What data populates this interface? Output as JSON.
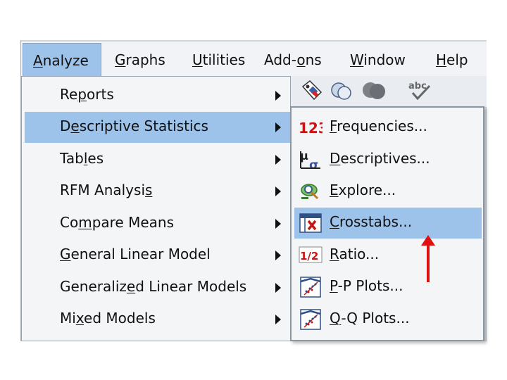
{
  "menubar": {
    "items": [
      {
        "label": "Analyze",
        "u": 0,
        "active": true
      },
      {
        "label": "Graphs",
        "u": 0
      },
      {
        "label": "Utilities",
        "u": 0
      },
      {
        "label": "Add-ons",
        "u": 4
      },
      {
        "label": "Window",
        "u": 0
      },
      {
        "label": "Help",
        "u": 0
      }
    ]
  },
  "toolbar": {
    "icons": [
      "value-labels-icon",
      "use-sets-icon",
      "show-all-variables-icon",
      "spell-check-icon"
    ],
    "spell_text": "abc"
  },
  "analyze_menu": {
    "items": [
      {
        "label": "Reports",
        "u": 2
      },
      {
        "label": "Descriptive Statistics",
        "u": 1,
        "highlighted": true
      },
      {
        "label": "Tables",
        "u": 3
      },
      {
        "label": "RFM Analysis",
        "u": 11
      },
      {
        "label": "Compare Means",
        "u": 2
      },
      {
        "label": "General Linear Model",
        "u": 0
      },
      {
        "label": "Generalized Linear Models",
        "u": 9
      },
      {
        "label": "Mixed Models",
        "u": 2
      }
    ]
  },
  "descriptive_submenu": {
    "items": [
      {
        "label": "Frequencies...",
        "u": 0,
        "icon": "frequencies-123-icon"
      },
      {
        "label": "Descriptives...",
        "u": 0,
        "icon": "descriptives-mu-sigma-icon"
      },
      {
        "label": "Explore...",
        "u": 0,
        "icon": "explore-magnifier-icon"
      },
      {
        "label": "Crosstabs...",
        "u": 0,
        "icon": "crosstabs-table-icon",
        "highlighted": true
      },
      {
        "label": "Ratio...",
        "u": 0,
        "icon": "ratio-half-icon"
      },
      {
        "label": "P-P Plots...",
        "u": 0,
        "icon": "pp-plot-icon"
      },
      {
        "label": "Q-Q Plots...",
        "u": 0,
        "icon": "qq-plot-icon"
      }
    ],
    "icon_text": {
      "frequencies": "123",
      "ratio": "1/2"
    }
  },
  "colors": {
    "highlight": "#9ec3ea",
    "annotation_arrow": "#e01010",
    "freq_red": "#c81414"
  }
}
